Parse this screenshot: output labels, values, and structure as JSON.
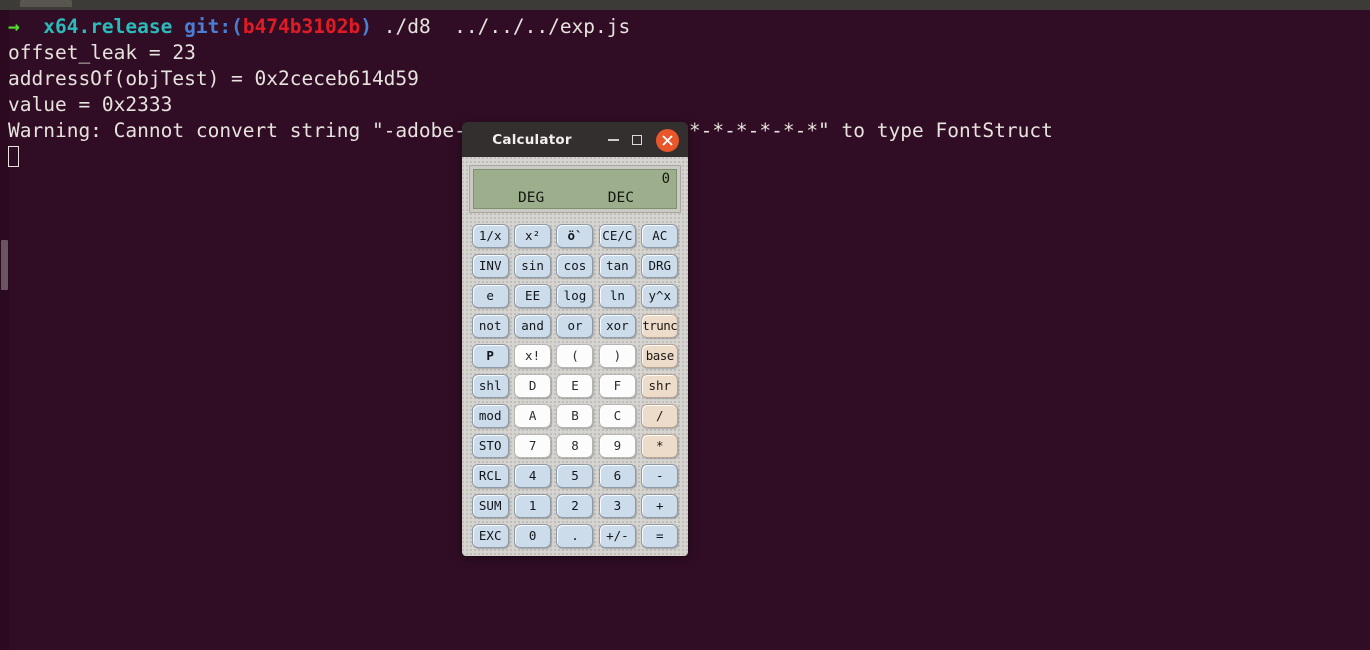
{
  "desktop": {
    "background_color": "#310d25",
    "top_bar_color": "#3d3b37"
  },
  "terminal": {
    "font_color": "#e6e3dd",
    "lines": [
      {
        "type": "prompt",
        "segments": [
          {
            "text": "→",
            "color": "#4fe22b"
          },
          {
            "text": "  x64.release",
            "color": "#2bbbbb"
          },
          {
            "text": " git:(",
            "color": "#4a7fd4"
          },
          {
            "text": "b474b3102b",
            "color": "#e01b24"
          },
          {
            "text": ")",
            "color": "#4a7fd4"
          },
          {
            "text": " ./d8  ../../../exp.js",
            "color": "#e6e3dd"
          }
        ]
      },
      {
        "type": "output",
        "text": "offset_leak = 23"
      },
      {
        "type": "output",
        "text": "addressOf(objTest) = 0x2ceceb614d59"
      },
      {
        "type": "output",
        "text": "value = 0x2333"
      },
      {
        "type": "output",
        "text": "Warning: Cannot convert string \"-adobe-symbol-*-*-*-*-120-*-*-*-*-*-*\" to type FontStruct"
      }
    ],
    "cursor_visible": true
  },
  "calculator": {
    "title": "Calculator",
    "titlebar": {
      "minimize_label": "minimize",
      "maximize_label": "maximize",
      "close_label": "close",
      "close_color": "#e8562a"
    },
    "display": {
      "value": "0",
      "angle_mode": "DEG",
      "number_base": "DEC",
      "lcd_color": "#9dae8c"
    },
    "keypad": {
      "rows": [
        [
          {
            "label": "1/x",
            "style": "blue"
          },
          {
            "label": "x²",
            "style": "blue"
          },
          {
            "label": "ö`",
            "style": "blue",
            "bold": true
          },
          {
            "label": "CE/C",
            "style": "blue"
          },
          {
            "label": "AC",
            "style": "blue"
          }
        ],
        [
          {
            "label": "INV",
            "style": "blue"
          },
          {
            "label": "sin",
            "style": "blue"
          },
          {
            "label": "cos",
            "style": "blue"
          },
          {
            "label": "tan",
            "style": "blue"
          },
          {
            "label": "DRG",
            "style": "blue"
          }
        ],
        [
          {
            "label": "e",
            "style": "blue"
          },
          {
            "label": "EE",
            "style": "blue"
          },
          {
            "label": "log",
            "style": "blue"
          },
          {
            "label": "ln",
            "style": "blue"
          },
          {
            "label": "y^x",
            "style": "blue"
          }
        ],
        [
          {
            "label": "not",
            "style": "blue"
          },
          {
            "label": "and",
            "style": "blue"
          },
          {
            "label": "or",
            "style": "blue"
          },
          {
            "label": "xor",
            "style": "blue"
          },
          {
            "label": "trunc",
            "style": "tan",
            "overflow": true
          }
        ],
        [
          {
            "label": "P",
            "style": "blue",
            "bold": true
          },
          {
            "label": "x!",
            "style": "white"
          },
          {
            "label": "(",
            "style": "white"
          },
          {
            "label": ")",
            "style": "white"
          },
          {
            "label": "base",
            "style": "tan",
            "overflow": true
          }
        ],
        [
          {
            "label": "shl",
            "style": "blue"
          },
          {
            "label": "D",
            "style": "white"
          },
          {
            "label": "E",
            "style": "white"
          },
          {
            "label": "F",
            "style": "white"
          },
          {
            "label": "shr",
            "style": "tan"
          }
        ],
        [
          {
            "label": "mod",
            "style": "blue"
          },
          {
            "label": "A",
            "style": "white"
          },
          {
            "label": "B",
            "style": "white"
          },
          {
            "label": "C",
            "style": "white"
          },
          {
            "label": "/",
            "style": "tan"
          }
        ],
        [
          {
            "label": "STO",
            "style": "blue"
          },
          {
            "label": "7",
            "style": "white"
          },
          {
            "label": "8",
            "style": "white"
          },
          {
            "label": "9",
            "style": "white"
          },
          {
            "label": "*",
            "style": "tan"
          }
        ],
        [
          {
            "label": "RCL",
            "style": "blue"
          },
          {
            "label": "4",
            "style": "blue"
          },
          {
            "label": "5",
            "style": "blue"
          },
          {
            "label": "6",
            "style": "blue"
          },
          {
            "label": "-",
            "style": "blue"
          }
        ],
        [
          {
            "label": "SUM",
            "style": "blue"
          },
          {
            "label": "1",
            "style": "blue"
          },
          {
            "label": "2",
            "style": "blue"
          },
          {
            "label": "3",
            "style": "blue"
          },
          {
            "label": "+",
            "style": "blue"
          }
        ],
        [
          {
            "label": "EXC",
            "style": "blue"
          },
          {
            "label": "0",
            "style": "blue"
          },
          {
            "label": ".",
            "style": "blue"
          },
          {
            "label": "+/-",
            "style": "blue"
          },
          {
            "label": "=",
            "style": "blue"
          }
        ]
      ]
    }
  }
}
